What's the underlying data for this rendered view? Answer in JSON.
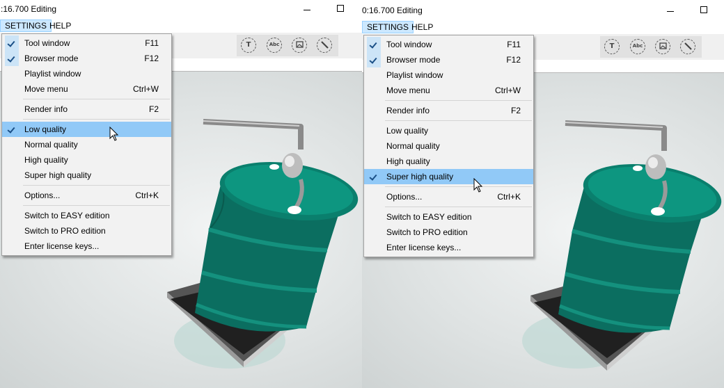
{
  "left": {
    "title": ":16.700 Editing",
    "menus": [
      "SETTINGS",
      "HELP"
    ],
    "toolbar_icons": [
      "T",
      "Abc",
      "image-icon",
      "pen-icon"
    ],
    "dropdown": {
      "items": [
        {
          "label": "Tool window",
          "shortcut": "F11",
          "checked": true
        },
        {
          "label": "Browser mode",
          "shortcut": "F12",
          "checked": true
        },
        {
          "label": "Playlist window",
          "shortcut": "",
          "checked": false
        },
        {
          "label": "Move menu",
          "shortcut": "Ctrl+W",
          "checked": false
        },
        {
          "separator": true
        },
        {
          "label": "Render info",
          "shortcut": "F2",
          "checked": false
        },
        {
          "separator": true
        },
        {
          "label": "Low quality",
          "shortcut": "",
          "checked": true,
          "highlighted": true
        },
        {
          "label": "Normal quality",
          "shortcut": "",
          "checked": false
        },
        {
          "label": "High quality",
          "shortcut": "",
          "checked": false
        },
        {
          "label": "Super high quality",
          "shortcut": "",
          "checked": false
        },
        {
          "separator": true
        },
        {
          "label": "Options...",
          "shortcut": "Ctrl+K",
          "checked": false
        },
        {
          "separator": true
        },
        {
          "label": "Switch to EASY edition",
          "shortcut": "",
          "checked": false
        },
        {
          "label": "Switch to PRO edition",
          "shortcut": "",
          "checked": false
        },
        {
          "label": "Enter license keys...",
          "shortcut": "",
          "checked": false
        }
      ]
    }
  },
  "right": {
    "title": "0:16.700 Editing",
    "menus": [
      "SETTINGS",
      "HELP"
    ],
    "toolbar_icons": [
      "T",
      "Abc",
      "image-icon",
      "pen-icon"
    ],
    "dropdown": {
      "items": [
        {
          "label": "Tool window",
          "shortcut": "F11",
          "checked": true
        },
        {
          "label": "Browser mode",
          "shortcut": "F12",
          "checked": true
        },
        {
          "label": "Playlist window",
          "shortcut": "",
          "checked": false
        },
        {
          "label": "Move menu",
          "shortcut": "Ctrl+W",
          "checked": false
        },
        {
          "separator": true
        },
        {
          "label": "Render info",
          "shortcut": "F2",
          "checked": false
        },
        {
          "separator": true
        },
        {
          "label": "Low quality",
          "shortcut": "",
          "checked": false
        },
        {
          "label": "Normal quality",
          "shortcut": "",
          "checked": false
        },
        {
          "label": "High quality",
          "shortcut": "",
          "checked": false
        },
        {
          "label": "Super high quality",
          "shortcut": "",
          "checked": true,
          "highlighted": true
        },
        {
          "separator": true
        },
        {
          "label": "Options...",
          "shortcut": "Ctrl+K",
          "checked": false
        },
        {
          "separator": true
        },
        {
          "label": "Switch to EASY edition",
          "shortcut": "",
          "checked": false
        },
        {
          "label": "Switch to PRO edition",
          "shortcut": "",
          "checked": false
        },
        {
          "label": "Enter license keys...",
          "shortcut": "",
          "checked": false
        }
      ]
    }
  },
  "colors": {
    "menu_highlight": "#91c9f7",
    "menu_active": "#cce8ff",
    "barrel": "#0e7d6c",
    "barrel_top": "#12a08a"
  }
}
